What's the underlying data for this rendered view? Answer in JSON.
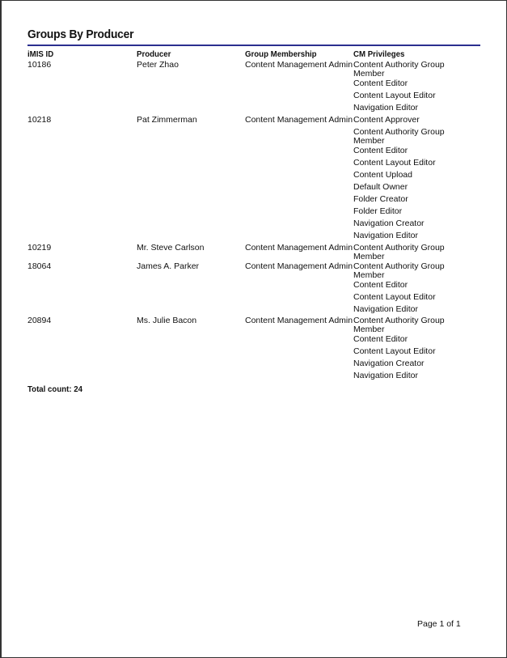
{
  "report": {
    "title": "Groups By Producer",
    "columns": [
      "iMIS ID",
      "Producer",
      "Group Membership",
      "CM Privileges"
    ],
    "rows": [
      {
        "id": "10186",
        "producer": "Peter Zhao",
        "group": "Content Management Admin",
        "privileges": [
          "Content Authority Group Member",
          "Content Editor",
          "Content Layout Editor",
          "Navigation Editor"
        ]
      },
      {
        "id": "10218",
        "producer": "Pat Zimmerman",
        "group": "Content Management Admin",
        "privileges": [
          "Content Approver",
          "Content Authority Group Member",
          "Content Editor",
          "Content Layout Editor",
          "Content Upload",
          "Default Owner",
          "Folder Creator",
          "Folder Editor",
          "Navigation Creator",
          "Navigation Editor"
        ]
      },
      {
        "id": "10219",
        "producer": "Mr. Steve Carlson",
        "group": "Content Management Admin",
        "privileges": [
          "Content Authority Group Member"
        ]
      },
      {
        "id": "18064",
        "producer": "James A. Parker",
        "group": "Content Management Admin",
        "privileges": [
          "Content Authority Group Member",
          "Content Editor",
          "Content Layout Editor",
          "Navigation Editor"
        ]
      },
      {
        "id": "20894",
        "producer": "Ms. Julie Bacon",
        "group": "Content Management Admin",
        "privileges": [
          "Content Authority Group Member",
          "Content Editor",
          "Content Layout Editor",
          "Navigation Creator",
          "Navigation Editor"
        ]
      }
    ],
    "total_label": "Total count: 24",
    "footer": "Page 1 of 1"
  }
}
